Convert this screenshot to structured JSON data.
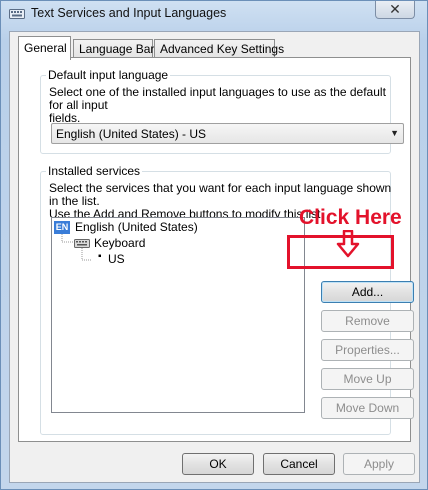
{
  "window": {
    "title": "Text Services and Input Languages",
    "close_label": "✕"
  },
  "tabs": [
    {
      "label": "General",
      "active": true
    },
    {
      "label": "Language Bar",
      "active": false
    },
    {
      "label": "Advanced Key Settings",
      "active": false
    }
  ],
  "default_input": {
    "group_label": "Default input language",
    "description": "Select one of the installed input languages to use as the default for all input fields.",
    "description_line1": "Select one of the installed input languages to use as the default for all input",
    "description_line2": "fields.",
    "selected": "English (United States) - US"
  },
  "installed_services": {
    "group_label": "Installed services",
    "description_line1": "Select the services that you want for each input language shown in the list.",
    "description_line2": "Use the Add and Remove buttons to modify this list.",
    "tree": {
      "language": "English (United States)",
      "language_badge": "EN",
      "category": "Keyboard",
      "layout": "US"
    },
    "buttons": {
      "add": "Add...",
      "remove": "Remove",
      "properties": "Properties...",
      "move_up": "Move Up",
      "move_down": "Move Down"
    }
  },
  "annotation": {
    "text": "Click Here",
    "color": "#e3122b"
  },
  "footer": {
    "ok": "OK",
    "cancel": "Cancel",
    "apply": "Apply"
  }
}
